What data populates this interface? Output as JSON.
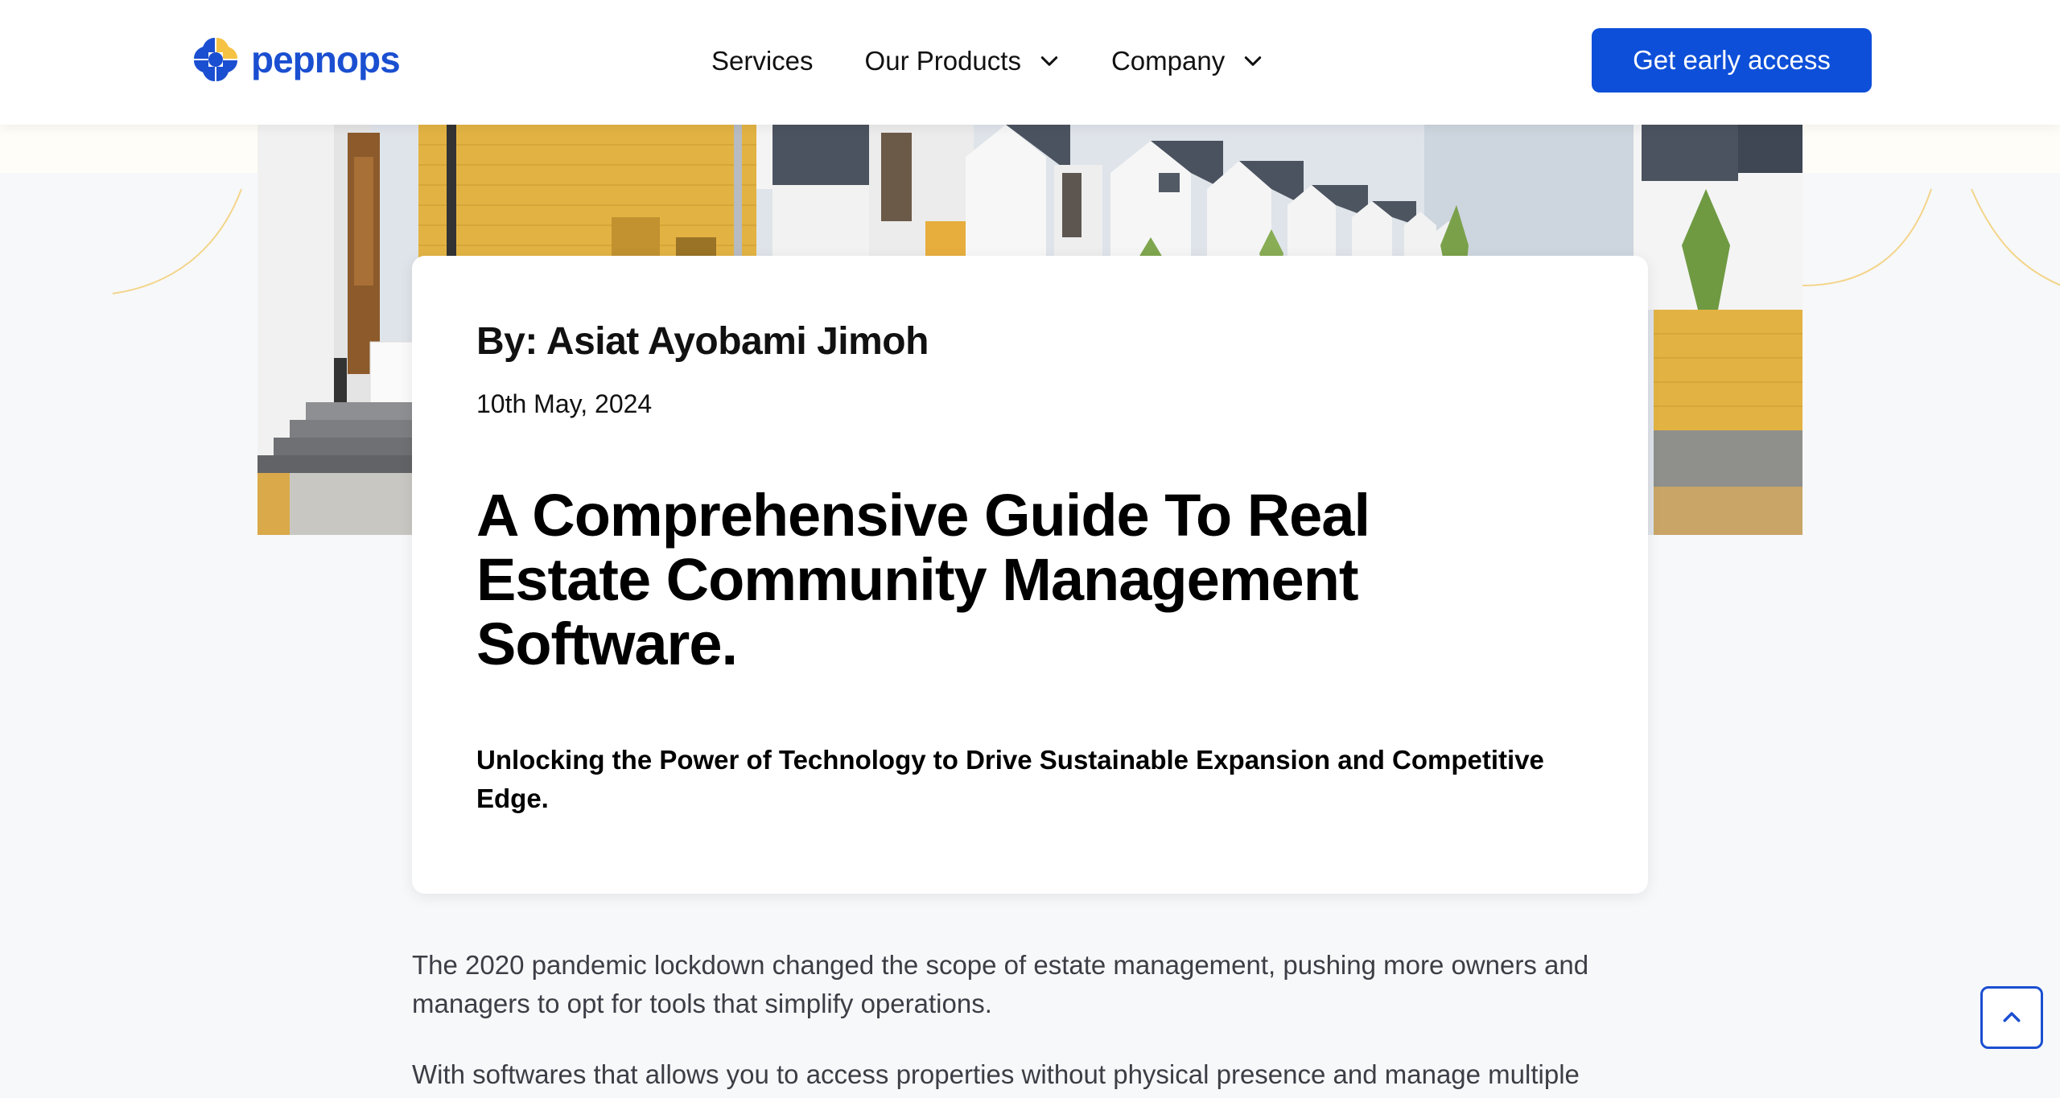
{
  "brand": {
    "name": "pepnops",
    "colors": {
      "primary": "#0d4fd8",
      "logo_blue": "#1b4fd1",
      "logo_yellow": "#f6c243",
      "text": "#000000",
      "body_text": "#3d3d45",
      "page_background": "#f7f8fa"
    }
  },
  "nav": {
    "items": [
      {
        "label": "Services",
        "has_dropdown": false
      },
      {
        "label": "Our Products",
        "has_dropdown": true,
        "icon": "chevron-down-icon"
      },
      {
        "label": "Company",
        "has_dropdown": true,
        "icon": "chevron-down-icon"
      }
    ],
    "cta_label": "Get early access"
  },
  "hero": {
    "image": "estate-houses-photo"
  },
  "article": {
    "author": "By: Asiat Ayobami Jimoh",
    "date": "10th May, 2024",
    "title": "A Comprehensive Guide To Real Estate Community Management Software.",
    "subtitle": "Unlocking the Power of Technology to Drive Sustainable Expansion and Competitive Edge.",
    "paragraphs": [
      "The 2020 pandemic lockdown changed the scope of estate management, pushing more owners and managers to opt for tools that simplify operations.",
      "With softwares that allows you to access properties without physical presence and manage multiple"
    ]
  },
  "scroll_top": {
    "icon": "chevron-up-icon"
  }
}
